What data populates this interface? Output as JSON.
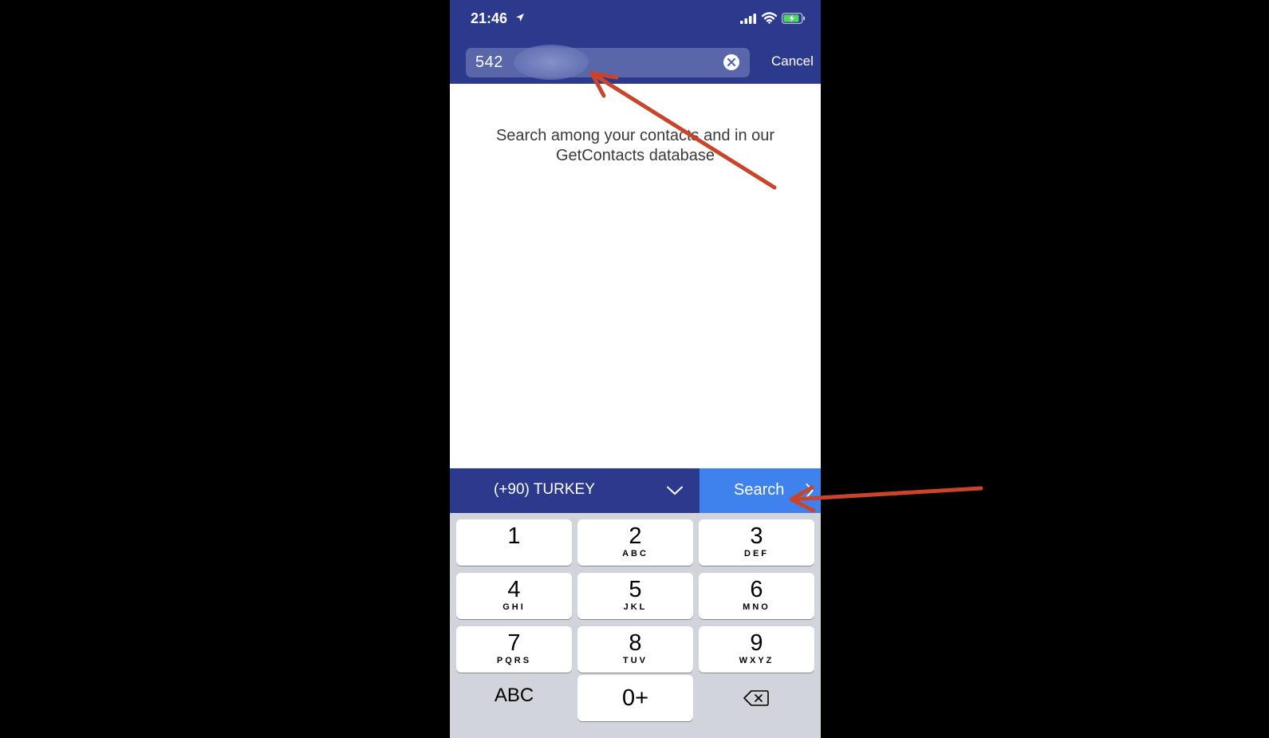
{
  "status_bar": {
    "time": "21:46"
  },
  "search": {
    "value": "542",
    "clear_icon": "clear-circle-icon"
  },
  "header": {
    "cancel_label": "Cancel"
  },
  "main": {
    "empty_message_line1": "Search among your contacts and in our",
    "empty_message_line2": "GetContacts database"
  },
  "country_selector": {
    "label": "(+90) TURKEY"
  },
  "search_button": {
    "label": "Search"
  },
  "keypad": {
    "keys": [
      {
        "digit": "1",
        "letters": ""
      },
      {
        "digit": "2",
        "letters": "ABC"
      },
      {
        "digit": "3",
        "letters": "DEF"
      },
      {
        "digit": "4",
        "letters": "GHI"
      },
      {
        "digit": "5",
        "letters": "JKL"
      },
      {
        "digit": "6",
        "letters": "MNO"
      },
      {
        "digit": "7",
        "letters": "PQRS"
      },
      {
        "digit": "8",
        "letters": "TUV"
      },
      {
        "digit": "9",
        "letters": "WXYZ"
      },
      {
        "digit": "0+",
        "letters": ""
      }
    ],
    "abc_label": "ABC"
  },
  "colors": {
    "header": "#2c3a8e",
    "search_button": "#3f82ee",
    "annotation_arrow": "#c8452c"
  }
}
